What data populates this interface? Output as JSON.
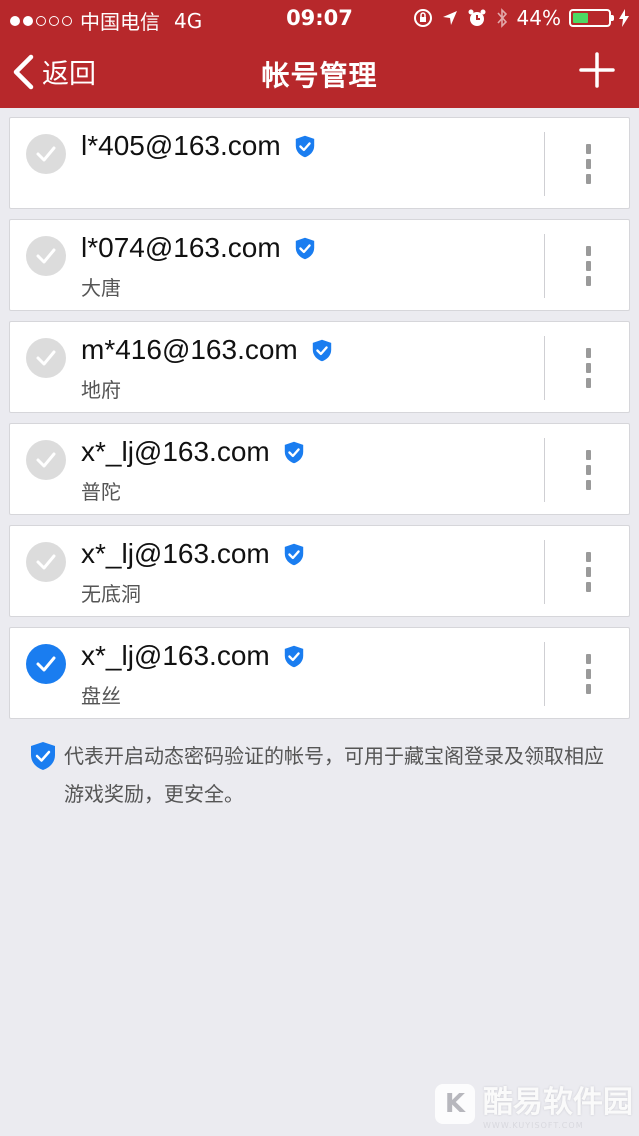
{
  "status_bar": {
    "carrier": "中国电信",
    "network": "4G",
    "time": "09:07",
    "battery": "44%",
    "battery_level": 0.44,
    "battery_color": "#4cd964"
  },
  "nav": {
    "back_label": "返回",
    "title": "帐号管理",
    "add_icon": "plus-icon",
    "background": "#b7282b"
  },
  "accounts": [
    {
      "email": "l*405@163.com",
      "server": "",
      "selected": false,
      "verified": true
    },
    {
      "email": "l*074@163.com",
      "server": "大唐",
      "selected": false,
      "verified": true
    },
    {
      "email": "m*416@163.com",
      "server": "地府",
      "selected": false,
      "verified": true
    },
    {
      "email": "x*_lj@163.com",
      "server": "普陀",
      "selected": false,
      "verified": true
    },
    {
      "email": "x*_lj@163.com",
      "server": "无底洞",
      "selected": false,
      "verified": true
    },
    {
      "email": "x*_lj@163.com",
      "server": "盘丝",
      "selected": true,
      "verified": true
    }
  ],
  "note": {
    "text": "代表开启动态密码验证的帐号，可用于藏宝阁登录及领取相应游戏奖励，更安全。"
  },
  "watermark": {
    "text": "酷易软件园",
    "sub": "WWW.KUYISOFT.COM"
  },
  "colors": {
    "accent_blue": "#1a7df0",
    "unselected_gray": "#dcdcdc"
  }
}
